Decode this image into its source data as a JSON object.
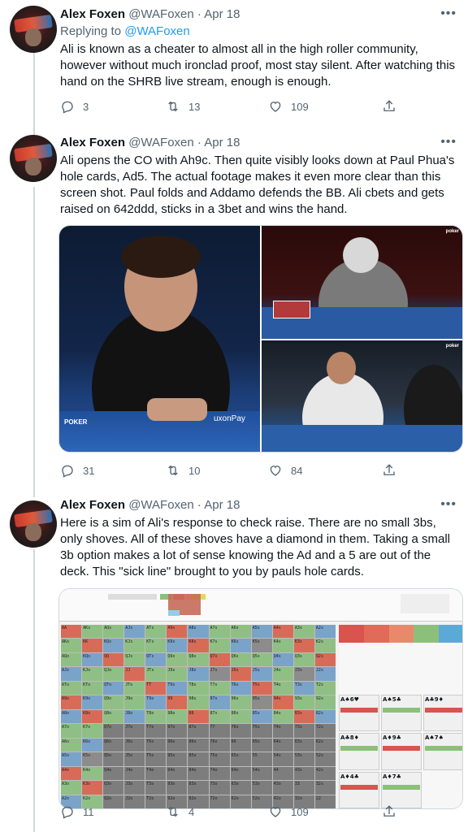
{
  "tweets": [
    {
      "author_name": "Alex Foxen",
      "handle": "@WAFoxen",
      "sep": "·",
      "date": "Apr 18",
      "replying_prefix": "Replying to ",
      "replying_to": "@WAFoxen",
      "text": "Ali is known as a cheater to almost all in the high roller community, however without much ironclad proof, most stay silent. After watching this hand on the SHRB live stream, enough is enough.",
      "replies": "3",
      "retweets": "13",
      "likes": "109"
    },
    {
      "author_name": "Alex Foxen",
      "handle": "@WAFoxen",
      "sep": "·",
      "date": "Apr 18",
      "text": "Ali opens the CO with Ah9c. Then quite visibly looks down at Paul Phua's hole cards, Ad5. The actual footage makes it even more clear than this screen shot. Paul folds and Addamo defends the BB. Ali cbets and gets raised on 642ddd, sticks in a 3bet and wins the hand.",
      "replies": "31",
      "retweets": "10",
      "likes": "84",
      "media_labels": {
        "table_brand": "uxonPay",
        "logo": "POKER",
        "logo_corner_1": "poker",
        "logo_corner_2": "poker"
      }
    },
    {
      "author_name": "Alex Foxen",
      "handle": "@WAFoxen",
      "sep": "·",
      "date": "Apr 18",
      "text": "Here is a sim of Ali's response to check raise. There are no small 3bs, only shoves. All of these shoves have a diamond in them. Taking a small 3b option makes a lot of sense knowing the Ad and a 5 are out of the deck. This \"sick line\" brought to you by pauls hole cards.",
      "replies": "11",
      "retweets": "4",
      "likes": "109"
    }
  ],
  "sim_labels": {
    "ranks": [
      "A",
      "K",
      "Q",
      "J",
      "T",
      "9",
      "8",
      "7",
      "6",
      "5",
      "4",
      "3",
      "2"
    ],
    "panel_hands": [
      "A♠6♥",
      "A♠5♣",
      "A♣9♦",
      "A♣8♦",
      "A♦9♣",
      "A♠7♠",
      "A♦4♣",
      "A♦7♣"
    ]
  }
}
